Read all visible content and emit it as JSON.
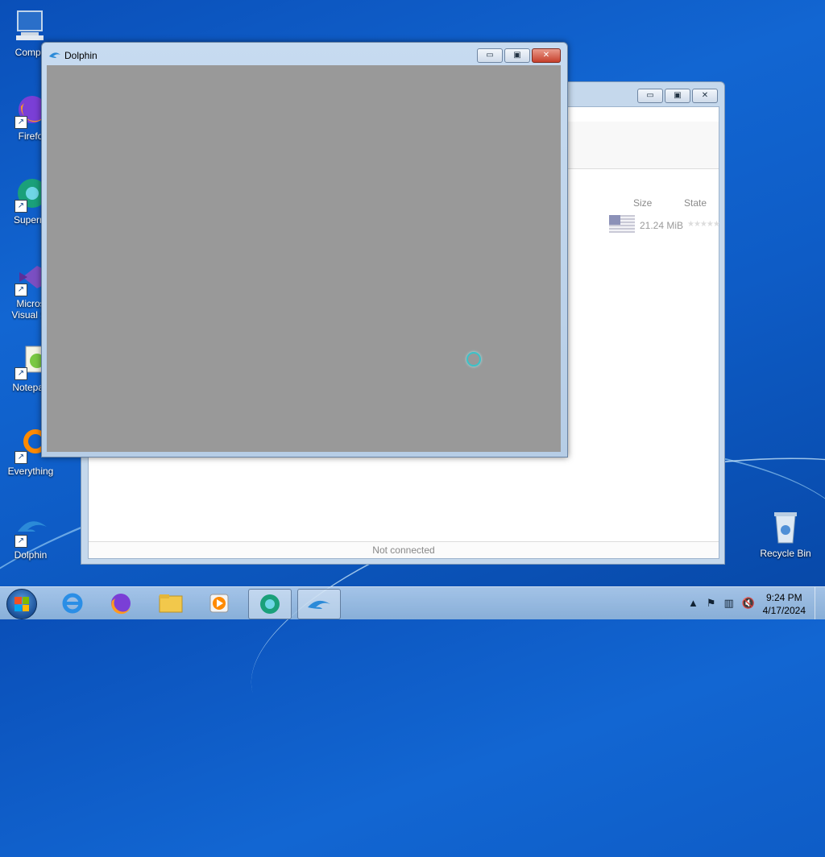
{
  "desktop": {
    "icons": [
      {
        "label": "Compu"
      },
      {
        "label": "Firefo"
      },
      {
        "label": "Superm"
      },
      {
        "label": "Micros\nVisual St"
      },
      {
        "label": "Notepad"
      },
      {
        "label": "Everything"
      },
      {
        "label": "Dolphin"
      },
      {
        "label": "Recycle Bin"
      }
    ]
  },
  "background_window": {
    "columns": {
      "size": "Size",
      "state": "State"
    },
    "row": {
      "size": "21.24 MiB",
      "stars": "★★★★★"
    },
    "status": "Not connected"
  },
  "main_window": {
    "title": "Dolphin",
    "buttons": {
      "minimize": "▭",
      "restore": "▣",
      "close": "✕"
    }
  },
  "taskbar": {
    "time": "9:24 PM",
    "date": "4/17/2024",
    "tray": {
      "expand": "▲"
    }
  },
  "colors": {
    "game_area": "#999999",
    "spinner": "#3cc2c8"
  }
}
